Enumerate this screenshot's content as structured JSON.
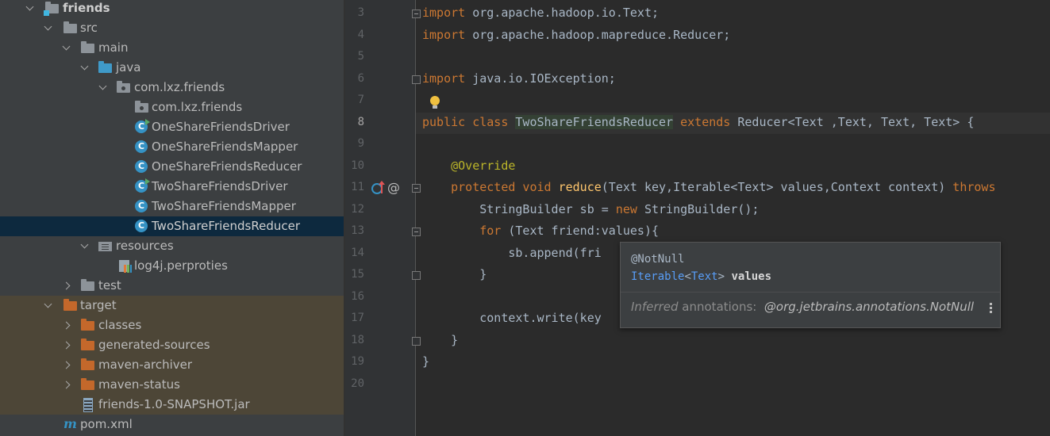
{
  "tree": {
    "items": [
      {
        "label": "friends",
        "icon": "module-folder-icon"
      },
      {
        "label": "src",
        "icon": "folder-icon"
      },
      {
        "label": "main",
        "icon": "folder-icon"
      },
      {
        "label": "java",
        "icon": "source-folder-icon"
      },
      {
        "label": "com.lxz.friends",
        "icon": "package-icon"
      },
      {
        "label": "com.lxz.friends",
        "icon": "package-icon"
      },
      {
        "label": "OneShareFriendsDriver",
        "icon": "runnable-class-icon"
      },
      {
        "label": "OneShareFriendsMapper",
        "icon": "class-icon"
      },
      {
        "label": "OneShareFriendsReducer",
        "icon": "class-icon"
      },
      {
        "label": "TwoShareFriendsDriver",
        "icon": "runnable-class-icon"
      },
      {
        "label": "TwoShareFriendsMapper",
        "icon": "class-icon"
      },
      {
        "label": "TwoShareFriendsReducer",
        "icon": "class-icon"
      },
      {
        "label": "resources",
        "icon": "resources-folder-icon"
      },
      {
        "label": "log4j.perproties",
        "icon": "properties-file-icon"
      },
      {
        "label": "test",
        "icon": "folder-icon"
      },
      {
        "label": "target",
        "icon": "excluded-folder-icon"
      },
      {
        "label": "classes",
        "icon": "excluded-folder-icon"
      },
      {
        "label": "generated-sources",
        "icon": "excluded-folder-icon"
      },
      {
        "label": "maven-archiver",
        "icon": "excluded-folder-icon"
      },
      {
        "label": "maven-status",
        "icon": "excluded-folder-icon"
      },
      {
        "label": "friends-1.0-SNAPSHOT.jar",
        "icon": "jar-icon"
      },
      {
        "label": "pom.xml",
        "icon": "maven-icon"
      }
    ],
    "selected": "TwoShareFriendsReducer"
  },
  "editor": {
    "line_numbers": [
      "3",
      "4",
      "5",
      "6",
      "7",
      "8",
      "9",
      "10",
      "11",
      "12",
      "13",
      "14",
      "15",
      "16",
      "17",
      "18",
      "19",
      "20"
    ],
    "current_line": "8",
    "code": {
      "l3_kw": "import",
      "l3_rest": " org.apache.hadoop.io.Text;",
      "l4_kw": "import",
      "l4_rest": " org.apache.hadoop.mapreduce.Reducer;",
      "l6_kw": "import",
      "l6_rest": " java.io.IOException;",
      "l8_kw1": "public class",
      "l8_cls": "TwoShareFriendsReducer",
      "l8_kw2": "extends",
      "l8_rest": " Reducer<Text ,Text, Text, Text> {",
      "l10_ann": "@Override",
      "l11_kw": "protected void",
      "l11_fn": "reduce",
      "l11_rest": "(Text key,Iterable<Text> values,Context context) ",
      "l11_kw2": "throws",
      "l12_pre": "StringBuilder sb = ",
      "l12_kw": "new",
      "l12_rest": " StringBuilder();",
      "l13_kw": "for",
      "l13_rest": " (Text friend:values){",
      "l14": "sb.append(fri",
      "l15": "}",
      "l17": "context.write(key",
      "l18": "}",
      "l19": "}"
    }
  },
  "tooltip": {
    "annotation": "@NotNull",
    "type_link": "Iterable",
    "lt": "<",
    "type_arg": "Text",
    "gt": ">",
    "param": "values",
    "inferred_word": "Inferred",
    "annotations_word": " annotations:",
    "inferred_value": "@org.jetbrains.annotations.NotNull"
  },
  "colors": {
    "keyword": "#cc7832",
    "annotation": "#bbb529",
    "function": "#ffc66d",
    "text": "#a9b7c6",
    "selection": "#0d293e"
  }
}
